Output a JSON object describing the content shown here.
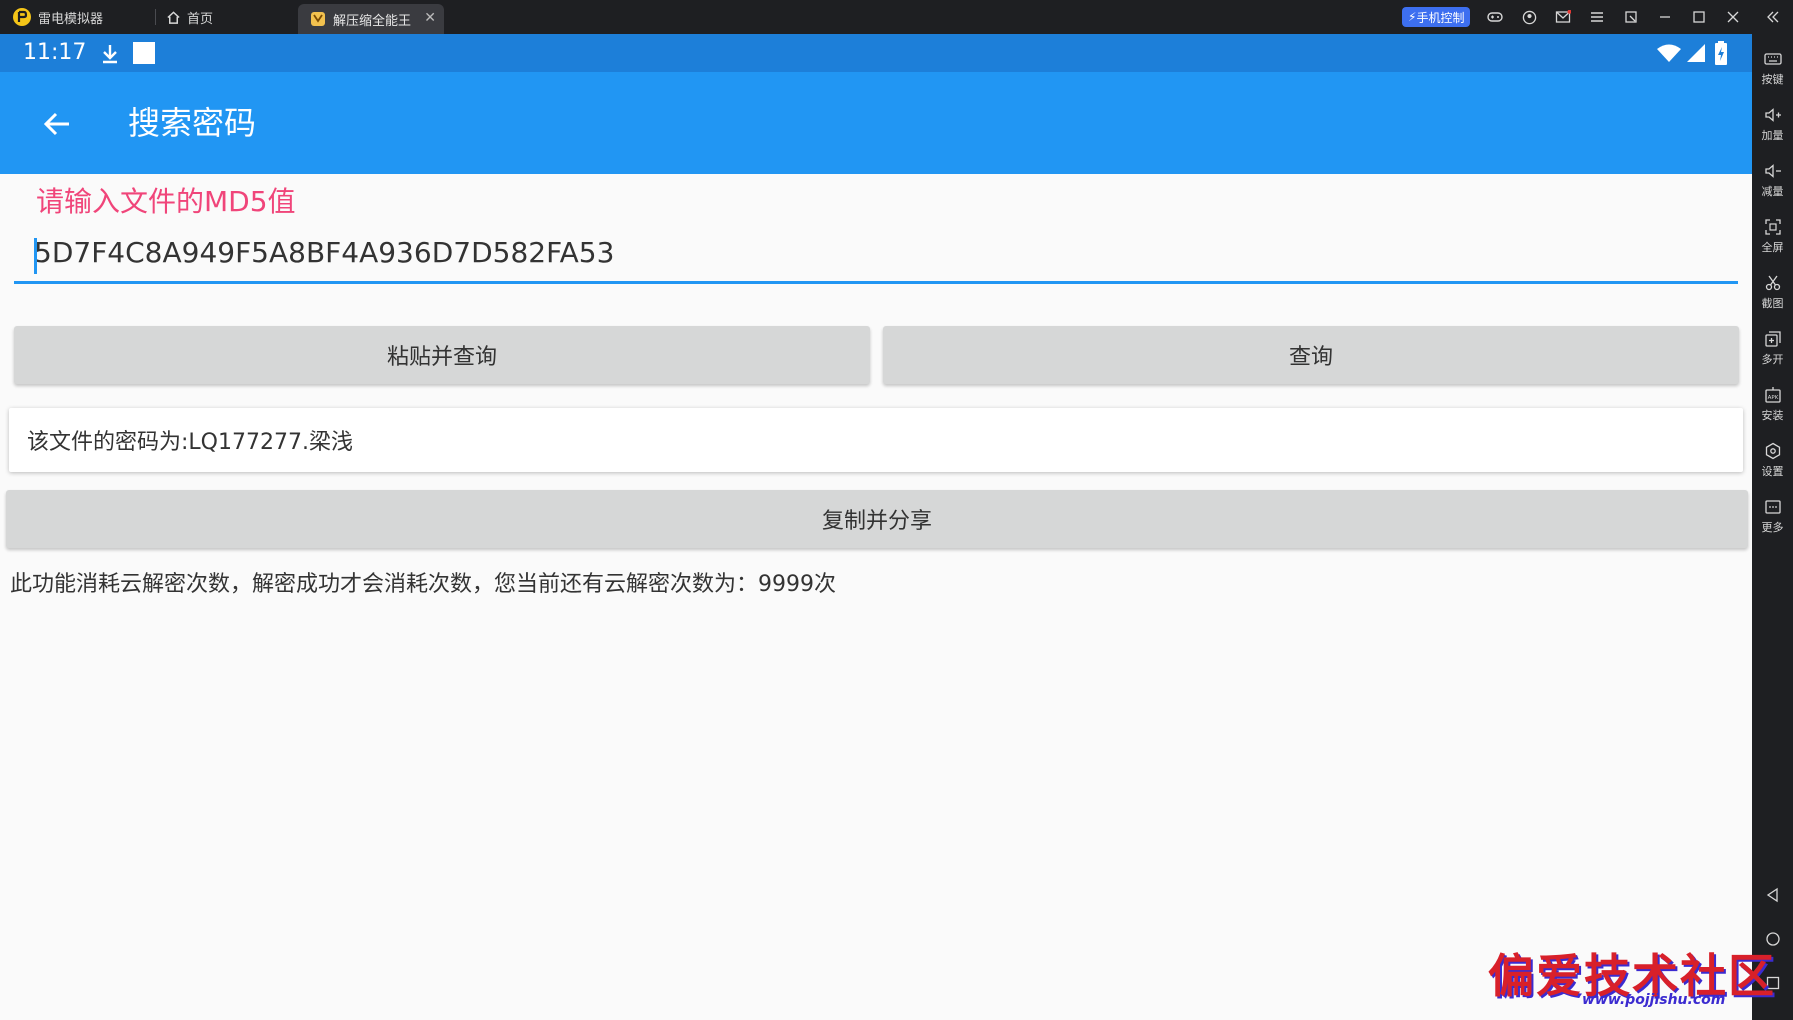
{
  "titlebar": {
    "app_name": "雷电模拟器",
    "home_tab": "首页",
    "active_tab": "解压缩全能王",
    "phone_control": "手机控制"
  },
  "sidebar": {
    "items": [
      {
        "label": "按键",
        "icon": "keyboard-icon"
      },
      {
        "label": "加量",
        "icon": "volume-up-icon"
      },
      {
        "label": "减量",
        "icon": "volume-down-icon"
      },
      {
        "label": "全屏",
        "icon": "fullscreen-icon"
      },
      {
        "label": "截图",
        "icon": "scissors-icon"
      },
      {
        "label": "多开",
        "icon": "multi-instance-icon"
      },
      {
        "label": "安装",
        "icon": "apk-install-icon"
      },
      {
        "label": "设置",
        "icon": "gear-icon"
      },
      {
        "label": "更多",
        "icon": "more-icon"
      }
    ]
  },
  "statusbar": {
    "time": "11:17"
  },
  "appbar": {
    "title": "搜索密码"
  },
  "form": {
    "hint": "请输入文件的MD5值",
    "md5_value": "5D7F4C8A949F5A8BF4A936D7D582FA53",
    "paste_query_label": "粘贴并查询",
    "query_label": "查询"
  },
  "result": {
    "text": "该文件的密码为:LQ177277.梁浅"
  },
  "copy_share_label": "复制并分享",
  "info_text": "此功能消耗云解密次数，解密成功才会消耗次数，您当前还有云解密次数为：9999次",
  "watermark": {
    "text": "偏爱技术社区",
    "url": "www.pojjishu.com"
  },
  "colors": {
    "status_bar": "#1d7fd9",
    "app_bar": "#2196f3",
    "hint": "#f0457a",
    "button": "#d6d7d7"
  }
}
